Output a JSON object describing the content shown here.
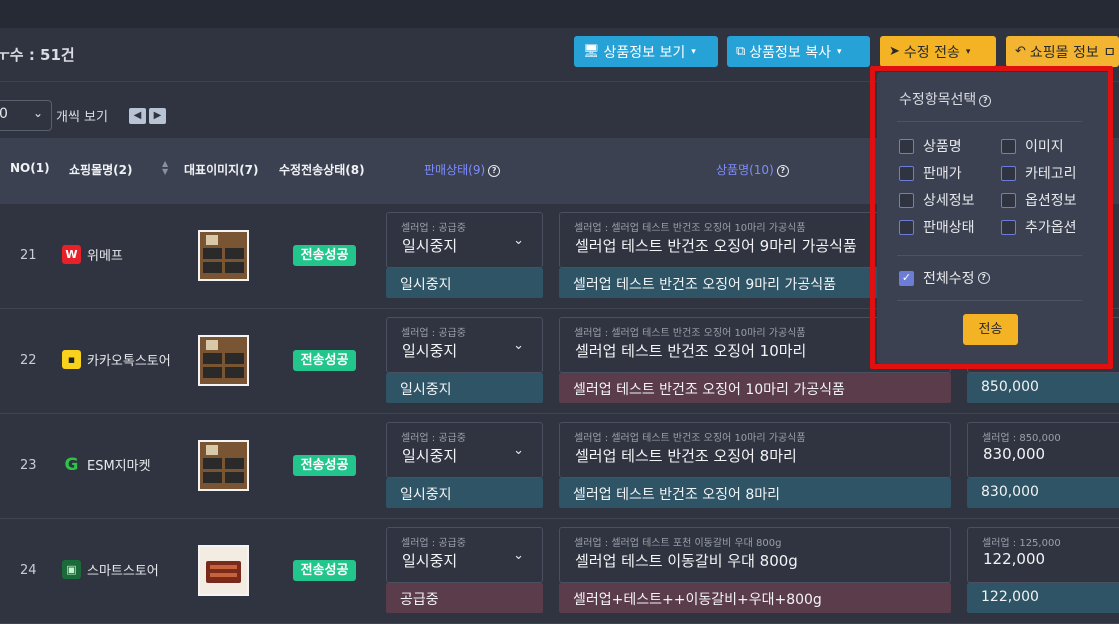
{
  "summary": {
    "count_text": "ㅜ수 : 51건"
  },
  "toolbar": {
    "view_info": "상품정보 보기",
    "copy_info": "상품정보 복사",
    "send_edit": "수정 전송",
    "mall_info": "쇼핑몰 정보 ㅁ"
  },
  "pager": {
    "per_page_value": "0",
    "per_page_label": "개씩 보기"
  },
  "table": {
    "headers": {
      "no": "NO(1)",
      "mall": "쇼핑몰명(2)",
      "image": "대표이미지(7)",
      "send_status": "수정전송상태(8)",
      "sale_status": "판매상태(9)",
      "product_name": "상품명(10)"
    },
    "rows": [
      {
        "no": "21",
        "mall": "위메프",
        "logo": "W",
        "send_status": "전송성공",
        "sale_small": "셀러업 : 공급중",
        "sale_value": "일시중지",
        "sale_bar": "일시중지",
        "sale_bar_color": "#2e5466",
        "name_small": "셀러업 : 셀러업 테스트 반건조 오징어 10마리 가공식품",
        "name_value": "셀러업 테스트 반건조 오징어 9마리 가공식품",
        "name_bar": "셀러업 테스트 반건조 오징어 9마리 가공식품",
        "name_bar_color": "#2e5466",
        "price_small": "",
        "price_value": "",
        "price_bar": ""
      },
      {
        "no": "22",
        "mall": "카카오톡스토어",
        "logo": "▪",
        "send_status": "전송성공",
        "sale_small": "셀러업 : 공급중",
        "sale_value": "일시중지",
        "sale_bar": "일시중지",
        "sale_bar_color": "#2e5466",
        "name_small": "셀러업 : 셀러업 테스트 반건조 오징어 10마리 가공식품",
        "name_value": "셀러업 테스트 반건조 오징어 10마리",
        "name_bar": "셀러업 테스트 반건조 오징어 10마리 가공식품",
        "name_bar_color": "#5a3c4b",
        "price_small": "",
        "price_value": "",
        "price_bar": "850,000"
      },
      {
        "no": "23",
        "mall": "ESM지마켓",
        "logo": "G",
        "send_status": "전송성공",
        "sale_small": "셀러업 : 공급중",
        "sale_value": "일시중지",
        "sale_bar": "일시중지",
        "sale_bar_color": "#2e5466",
        "name_small": "셀러업 : 셀러업 테스트 반건조 오징어 10마리 가공식품",
        "name_value": "셀러업 테스트 반건조 오징어 8마리",
        "name_bar": "셀러업 테스트 반건조 오징어 8마리",
        "name_bar_color": "#2e5466",
        "price_small": "셀러업 : 850,000",
        "price_value": "830,000",
        "price_bar": "830,000"
      },
      {
        "no": "24",
        "mall": "스마트스토어",
        "logo": "▣",
        "send_status": "전송성공",
        "sale_small": "셀러업 : 공급중",
        "sale_value": "일시중지",
        "sale_bar": "공급중",
        "sale_bar_color": "#5a3c4b",
        "name_small": "셀러업 : 셀러업 테스트 포천 이동갈비 우대 800g",
        "name_value": "셀러업 테스트  이동갈비 우대 800g",
        "name_bar": "셀러업+테스트++이동갈비+우대+800g",
        "name_bar_color": "#5a3c4b",
        "price_small": "셀러업 : 125,000",
        "price_value": "122,000",
        "price_bar": "122,000"
      }
    ]
  },
  "popup": {
    "title": "수정항목선택",
    "options": [
      "상품명",
      "이미지",
      "판매가",
      "카테고리",
      "상세정보",
      "옵션정보",
      "판매상태",
      "추가옵션"
    ],
    "all_label": "전체수정",
    "all_checked": true,
    "send_label": "전송"
  },
  "colors": {
    "accent_blue": "#27a2d6",
    "accent_yellow": "#f4b324",
    "success": "#22c58b",
    "highlight_frame": "#e01010"
  }
}
